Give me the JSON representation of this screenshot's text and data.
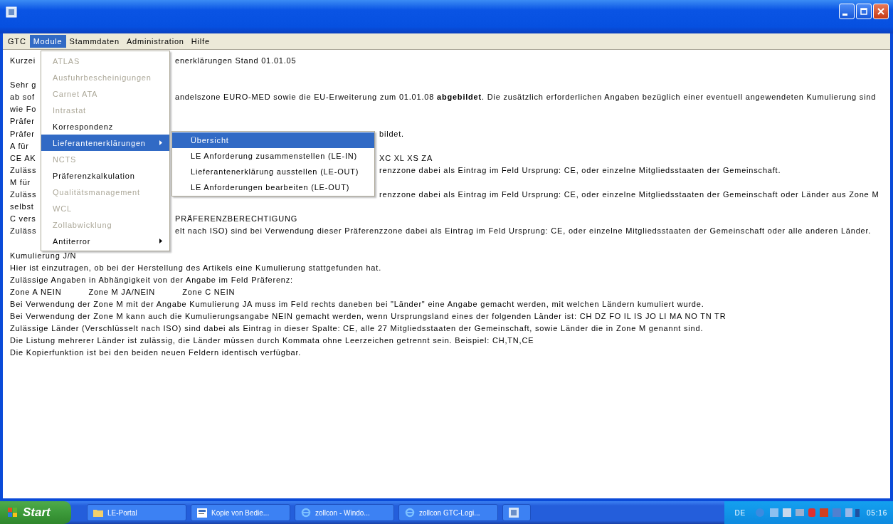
{
  "menubar": [
    {
      "label": "GTC",
      "selected": false
    },
    {
      "label": "Module",
      "selected": true
    },
    {
      "label": "Stammdaten",
      "selected": false
    },
    {
      "label": "Administration",
      "selected": false
    },
    {
      "label": "Hilfe",
      "selected": false
    }
  ],
  "document_lines": [
    {
      "kind": "menu_gap",
      "left": "Kurzei",
      "right": "enerklärungen Stand 01.01.05"
    },
    {
      "kind": "blank"
    },
    {
      "kind": "menu_gap",
      "left": "Sehr g"
    },
    {
      "kind": "menu_gap",
      "left": "ab sof",
      "right": "andelszone EURO-MED sowie die EU-Erweiterung zum 01.01.08 **abgebildet**. Die zusätzlich erforderlichen Angaben bezüglich einer eventuell angewendeten Kumulierung sind"
    },
    {
      "kind": "menu_gap",
      "left": "wie Fo"
    },
    {
      "kind": "menu_gap",
      "left": "Präfer"
    },
    {
      "kind": "submenu_gap",
      "left": "Präfer",
      "right": "bildet."
    },
    {
      "kind": "menu_gap",
      "left": "A für"
    },
    {
      "kind": "submenu_gap",
      "left": "CE AK",
      "right": "XC XL XS ZA"
    },
    {
      "kind": "submenu_gap",
      "left": "Zuläss",
      "right": "renzzone dabei als Eintrag im Feld Ursprung: CE, oder einzelne Mitgliedsstaaten der Gemeinschaft."
    },
    {
      "kind": "menu_gap",
      "left": "M für"
    },
    {
      "kind": "submenu_gap",
      "left": "Zuläss",
      "right": "renzzone dabei als Eintrag im Feld Ursprung: CE, oder einzelne Mitgliedsstaaten der Gemeinschaft oder Länder aus Zone M"
    },
    {
      "kind": "menu_gap",
      "left": "selbst"
    },
    {
      "kind": "menu_gap",
      "left": "C vers",
      "right": "PRÄFERENZBERECHTIGUNG"
    },
    {
      "kind": "menu_gap",
      "left": "Zuläss",
      "right": "elt nach ISO) sind bei Verwendung dieser Präferenzzone dabei als Eintrag im Feld Ursprung: CE, oder einzelne Mitgliedsstaaten der Gemeinschaft oder alle anderen Länder."
    },
    {
      "kind": "blank"
    },
    {
      "kind": "full",
      "text": "Kumulierung J/N"
    },
    {
      "kind": "full",
      "text": "Hier ist einzutragen, ob bei der Herstellung des Artikels eine Kumulierung stattgefunden hat."
    },
    {
      "kind": "full",
      "text": "Zulässige Angaben in Abhängigkeit von der Angabe im Feld Präferenz:"
    },
    {
      "kind": "zones",
      "parts": [
        "Zone A NEIN",
        "Zone M JA/NEIN",
        "Zone C NEIN"
      ]
    },
    {
      "kind": "full",
      "text": "Bei Verwendung der Zone M mit der Angabe Kumulierung JA muss im Feld rechts daneben bei \"Länder\" eine Angabe gemacht werden, mit welchen Ländern kumuliert wurde."
    },
    {
      "kind": "full",
      "text": "Bei Verwendung der Zone M kann auch die Kumulierungsangabe NEIN gemacht werden, wenn Ursprungsland eines der folgenden Länder ist: CH DZ FO IL IS JO LI MA NO TN TR"
    },
    {
      "kind": "full",
      "text": "Zulässige Länder (Verschlüsselt nach ISO) sind dabei als Eintrag in dieser Spalte: CE, alle 27 Mitgliedsstaaten der Gemeinschaft, sowie Länder die in Zone M genannt sind."
    },
    {
      "kind": "full",
      "text": "Die Listung mehrerer Länder ist zulässig, die Länder müssen durch Kommata ohne Leerzeichen getrennt sein. Beispiel: CH,TN,CE"
    },
    {
      "kind": "full",
      "text": "Die Kopierfunktion ist bei den beiden neuen Feldern identisch verfügbar."
    }
  ],
  "module_menu": [
    {
      "label": "ATLAS",
      "disabled": true,
      "selected": false,
      "submenu": false
    },
    {
      "label": "Ausfuhrbescheinigungen",
      "disabled": true,
      "selected": false,
      "submenu": false
    },
    {
      "label": "Carnet ATA",
      "disabled": true,
      "selected": false,
      "submenu": false
    },
    {
      "label": "Intrastat",
      "disabled": true,
      "selected": false,
      "submenu": false
    },
    {
      "label": "Korrespondenz",
      "disabled": false,
      "selected": false,
      "submenu": false
    },
    {
      "label": "Lieferantenerklärungen",
      "disabled": false,
      "selected": true,
      "submenu": true
    },
    {
      "label": "NCTS",
      "disabled": true,
      "selected": false,
      "submenu": false
    },
    {
      "label": "Präferenzkalkulation",
      "disabled": false,
      "selected": false,
      "submenu": false
    },
    {
      "label": "Qualitätsmanagement",
      "disabled": true,
      "selected": false,
      "submenu": false
    },
    {
      "label": "WCL",
      "disabled": true,
      "selected": false,
      "submenu": false
    },
    {
      "label": "Zollabwicklung",
      "disabled": true,
      "selected": false,
      "submenu": false
    },
    {
      "label": "Antiterror",
      "disabled": false,
      "selected": false,
      "submenu": true
    }
  ],
  "submenu": [
    {
      "label": "Übersicht",
      "selected": true
    },
    {
      "label": "LE Anforderung zusammenstellen (LE-IN)",
      "selected": false
    },
    {
      "label": "Lieferantenerklärung ausstellen (LE-OUT)",
      "selected": false
    },
    {
      "label": "LE Anforderungen bearbeiten (LE-OUT)",
      "selected": false
    }
  ],
  "taskbar": {
    "start": "Start",
    "tasks": [
      {
        "label": "LE-Portal",
        "kind": "folder"
      },
      {
        "label": "Kopie von Bedie...",
        "kind": "document"
      },
      {
        "label": "zollcon - Windo...",
        "kind": "browser"
      },
      {
        "label": "zollcon GTC-Logi...",
        "kind": "browser"
      },
      {
        "kind": "app"
      }
    ],
    "language": "DE",
    "clock": "05:16"
  }
}
